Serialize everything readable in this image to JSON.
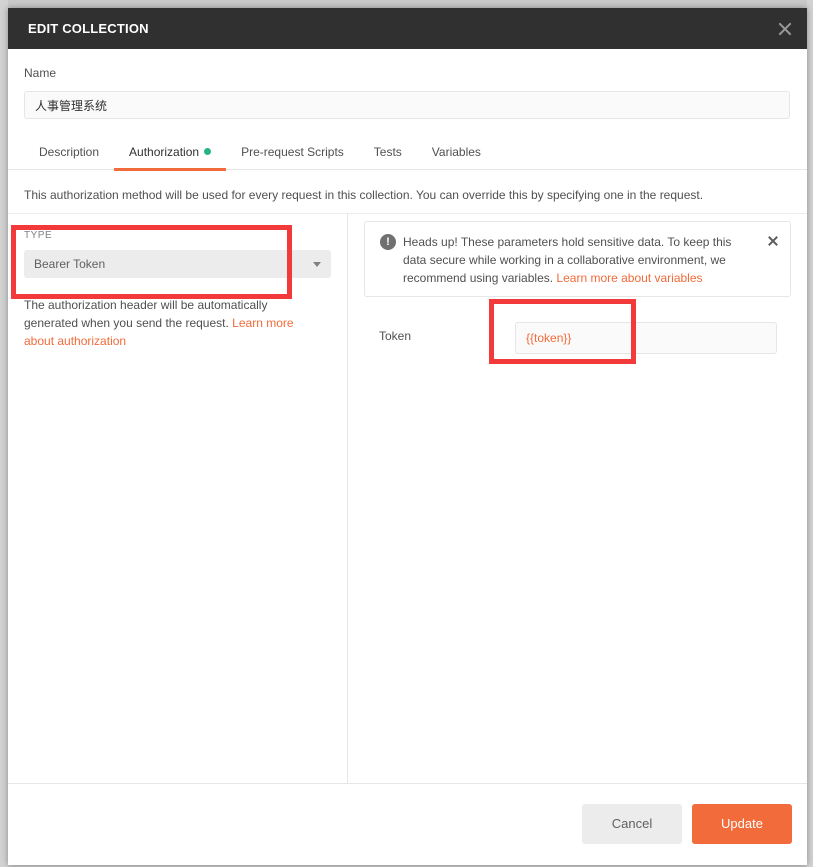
{
  "modal": {
    "title": "EDIT COLLECTION"
  },
  "name": {
    "label": "Name",
    "value": "人事管理系统"
  },
  "tabs": [
    {
      "label": "Description",
      "active": false
    },
    {
      "label": "Authorization",
      "active": true
    },
    {
      "label": "Pre-request Scripts",
      "active": false
    },
    {
      "label": "Tests",
      "active": false
    },
    {
      "label": "Variables",
      "active": false
    }
  ],
  "auth": {
    "info": "This authorization method will be used for every request in this collection. You can override this by specifying one in the request.",
    "type_label": "TYPE",
    "type_value": "Bearer Token",
    "description": "The authorization header will be automatically generated when you send the request.",
    "description_link": "Learn more about authorization"
  },
  "alert": {
    "text": "Heads up! These parameters hold sensitive data. To keep this data secure while working in a collaborative environment, we recommend using variables.",
    "link": "Learn more about variables"
  },
  "token": {
    "label": "Token",
    "value": "{{token}}"
  },
  "footer": {
    "cancel_label": "Cancel",
    "update_label": "Update"
  },
  "colors": {
    "accent": "#f26b3a",
    "header_bg": "#303030",
    "status_dot": "#26b47f",
    "annotation": "#f23a3a"
  }
}
